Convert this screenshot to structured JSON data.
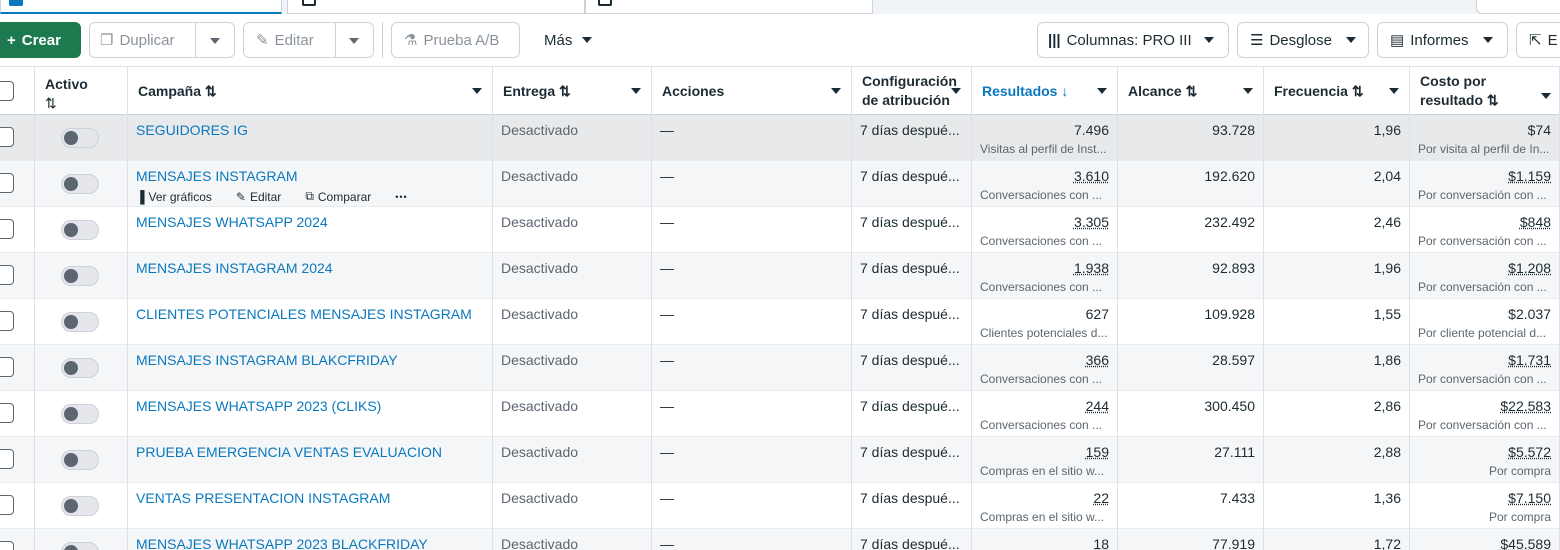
{
  "toolbar": {
    "create_label": "Crear",
    "duplicate_label": "Duplicar",
    "edit_label": "Editar",
    "ab_test_label": "Prueba A/B",
    "more_label": "Más",
    "columns_label": "Columnas: PRO III",
    "breakdown_label": "Desglose",
    "reports_label": "Informes",
    "export_label": "E"
  },
  "headers": {
    "active": "Activo",
    "active_sort": "⇅",
    "campaign": "Campaña ⇅",
    "delivery": "Entrega ⇅",
    "actions": "Acciones",
    "attribution": "Configuración de atribución",
    "results": "Resultados ↓",
    "reach": "Alcance ⇅",
    "frequency": "Frecuencia ⇅",
    "cost": "Costo por resultado ⇅"
  },
  "row_actions": {
    "charts": "Ver gráficos",
    "edit": "Editar",
    "compare": "Comparar",
    "more": "•••"
  },
  "rows": [
    {
      "campaign": "SEGUIDORES IG",
      "delivery": "Desactivado",
      "actions": "—",
      "attribution": "7 días despué...",
      "results": "7.496",
      "results_sub": "Visitas al perfil de Inst...",
      "reach": "93.728",
      "frequency": "1,96",
      "cost": "$74",
      "cost_sub": "Por visita al perfil de In..."
    },
    {
      "campaign": "MENSAJES INSTAGRAM",
      "delivery": "Desactivado",
      "actions": "—",
      "attribution": "7 días despué...",
      "results": "3.610",
      "results_sub": "Conversaciones con ...",
      "reach": "192.620",
      "frequency": "2,04",
      "cost": "$1.159",
      "cost_sub": "Por conversación con ..."
    },
    {
      "campaign": "MENSAJES WHATSAPP 2024",
      "delivery": "Desactivado",
      "actions": "—",
      "attribution": "7 días despué...",
      "results": "3.305",
      "results_sub": "Conversaciones con ...",
      "reach": "232.492",
      "frequency": "2,46",
      "cost": "$848",
      "cost_sub": "Por conversación con ..."
    },
    {
      "campaign": "MENSAJES INSTAGRAM 2024",
      "delivery": "Desactivado",
      "actions": "—",
      "attribution": "7 días despué...",
      "results": "1.938",
      "results_sub": "Conversaciones con ...",
      "reach": "92.893",
      "frequency": "1,96",
      "cost": "$1.208",
      "cost_sub": "Por conversación con ..."
    },
    {
      "campaign": "CLIENTES POTENCIALES MENSAJES INSTAGRAM",
      "delivery": "Desactivado",
      "actions": "—",
      "attribution": "7 días despué...",
      "results": "627",
      "results_sub": "Clientes potenciales d...",
      "reach": "109.928",
      "frequency": "1,55",
      "cost": "$2.037",
      "cost_sub": "Por cliente potencial d..."
    },
    {
      "campaign": "MENSAJES INSTAGRAM BLAKCFRIDAY",
      "delivery": "Desactivado",
      "actions": "—",
      "attribution": "7 días despué...",
      "results": "366",
      "results_sub": "Conversaciones con ...",
      "reach": "28.597",
      "frequency": "1,86",
      "cost": "$1.731",
      "cost_sub": "Por conversación con ..."
    },
    {
      "campaign": "MENSAJES WHATSAPP 2023 (CLIKS)",
      "delivery": "Desactivado",
      "actions": "—",
      "attribution": "7 días despué...",
      "results": "244",
      "results_sub": "Conversaciones con ...",
      "reach": "300.450",
      "frequency": "2,86",
      "cost": "$22.583",
      "cost_sub": "Por conversación con ..."
    },
    {
      "campaign": "PRUEBA EMERGENCIA VENTAS EVALUACION",
      "delivery": "Desactivado",
      "actions": "—",
      "attribution": "7 días despué...",
      "results": "159",
      "results_sub": "Compras en el sitio w...",
      "reach": "27.111",
      "frequency": "2,88",
      "cost": "$5.572",
      "cost_sub": "Por compra"
    },
    {
      "campaign": "VENTAS PRESENTACION INSTAGRAM",
      "delivery": "Desactivado",
      "actions": "—",
      "attribution": "7 días despué...",
      "results": "22",
      "results_sub": "Compras en el sitio w...",
      "reach": "7.433",
      "frequency": "1,36",
      "cost": "$7.150",
      "cost_sub": "Por compra"
    },
    {
      "campaign": "MENSAJES WHATSAPP 2023 BLACKFRIDAY",
      "delivery": "Desactivado",
      "actions": "—",
      "attribution": "7 días despué...",
      "results": "18",
      "results_sub": "",
      "reach": "77.919",
      "frequency": "1,72",
      "cost": "$45.589",
      "cost_sub": ""
    }
  ]
}
